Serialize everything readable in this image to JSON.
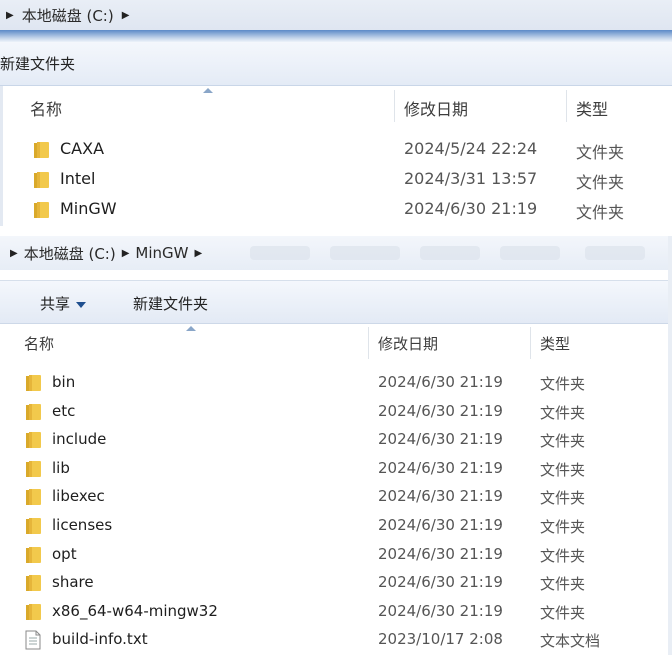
{
  "window1": {
    "breadcrumb": [
      "本地磁盘 (C:)"
    ],
    "toolbar": {
      "new_folder": "新建文件夹"
    },
    "columns": {
      "name": "名称",
      "date": "修改日期",
      "type": "类型"
    },
    "rows": [
      {
        "name": "CAXA",
        "date": "2024/5/24 22:24",
        "type": "文件夹",
        "icon": "folder-icon"
      },
      {
        "name": "Intel",
        "date": "2024/3/31 13:57",
        "type": "文件夹",
        "icon": "folder-icon"
      },
      {
        "name": "MinGW",
        "date": "2024/6/30 21:19",
        "type": "文件夹",
        "icon": "folder-icon"
      }
    ]
  },
  "window2": {
    "breadcrumb": [
      "本地磁盘 (C:)",
      "MinGW"
    ],
    "toolbar": {
      "share": "共享",
      "new_folder": "新建文件夹"
    },
    "columns": {
      "name": "名称",
      "date": "修改日期",
      "type": "类型"
    },
    "rows": [
      {
        "name": "bin",
        "date": "2024/6/30 21:19",
        "type": "文件夹",
        "icon": "folder-icon"
      },
      {
        "name": "etc",
        "date": "2024/6/30 21:19",
        "type": "文件夹",
        "icon": "folder-icon"
      },
      {
        "name": "include",
        "date": "2024/6/30 21:19",
        "type": "文件夹",
        "icon": "folder-icon"
      },
      {
        "name": "lib",
        "date": "2024/6/30 21:19",
        "type": "文件夹",
        "icon": "folder-icon"
      },
      {
        "name": "libexec",
        "date": "2024/6/30 21:19",
        "type": "文件夹",
        "icon": "folder-icon"
      },
      {
        "name": "licenses",
        "date": "2024/6/30 21:19",
        "type": "文件夹",
        "icon": "folder-icon"
      },
      {
        "name": "opt",
        "date": "2024/6/30 21:19",
        "type": "文件夹",
        "icon": "folder-icon"
      },
      {
        "name": "share",
        "date": "2024/6/30 21:19",
        "type": "文件夹",
        "icon": "folder-icon"
      },
      {
        "name": "x86_64-w64-mingw32",
        "date": "2024/6/30 21:19",
        "type": "文件夹",
        "icon": "folder-icon"
      },
      {
        "name": "build-info.txt",
        "date": "2023/10/17 2:08",
        "type": "文本文档",
        "icon": "text-file-icon"
      }
    ]
  },
  "colors": {
    "folder_yellow": "#f2c94c",
    "folder_dark": "#d9a92a",
    "header_blue": "#5b89c7"
  }
}
